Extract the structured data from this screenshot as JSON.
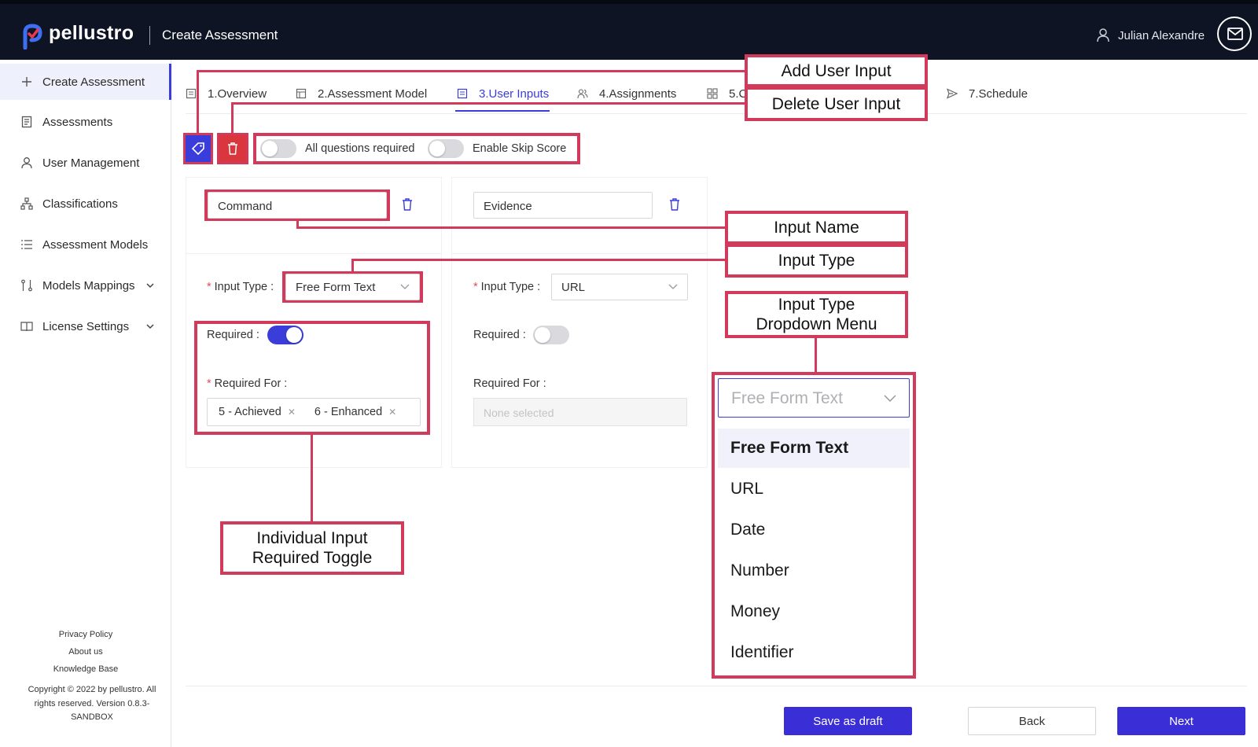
{
  "header": {
    "brand": "pellustro",
    "page_title": "Create Assessment",
    "user_name": "Julian Alexandre"
  },
  "sidebar": {
    "items": [
      {
        "label": "Create Assessment",
        "icon": "plus-icon"
      },
      {
        "label": "Assessments",
        "icon": "document-list-icon"
      },
      {
        "label": "User Management",
        "icon": "user-icon"
      },
      {
        "label": "Classifications",
        "icon": "hierarchy-icon"
      },
      {
        "label": "Assessment Models",
        "icon": "list-icon"
      },
      {
        "label": "Models Mappings",
        "icon": "mapping-icon"
      },
      {
        "label": "License Settings",
        "icon": "book-icon"
      }
    ],
    "footer_links": [
      "Privacy Policy",
      "About us",
      "Knowledge Base"
    ],
    "copyright": "Copyright © 2022 by pellustro. All rights reserved. Version 0.8.3-SANDBOX"
  },
  "tabs": [
    {
      "label": "1.Overview"
    },
    {
      "label": "2.Assessment Model"
    },
    {
      "label": "3.User Inputs"
    },
    {
      "label": "4.Assignments"
    },
    {
      "label": "5.C"
    },
    {
      "label": "7.Schedule"
    }
  ],
  "toolbar": {
    "all_required_label": "All questions required",
    "skip_score_label": "Enable Skip Score"
  },
  "inputs": [
    {
      "name": "Command",
      "input_type_label": "Input Type :",
      "input_type": "Free Form Text",
      "required_label": "Required :",
      "required": true,
      "required_for_label": "Required For :",
      "required_for": [
        "5 - Achieved",
        "6 - Enhanced"
      ]
    },
    {
      "name": "Evidence",
      "input_type_label": "Input Type :",
      "input_type": "URL",
      "required_label": "Required :",
      "required": false,
      "required_for_label": "Required For :",
      "required_for_placeholder": "None selected"
    }
  ],
  "dropdown": {
    "selected_placeholder": "Free Form Text",
    "options": [
      "Free Form Text",
      "URL",
      "Date",
      "Number",
      "Money",
      "Identifier"
    ]
  },
  "annotations": {
    "add_user_input": "Add User Input",
    "delete_user_input": "Delete User Input",
    "input_name": "Input Name",
    "input_type": "Input Type",
    "input_type_dropdown_l1": "Input Type",
    "input_type_dropdown_l2": "Dropdown Menu",
    "required_toggle_l1": "Individual Input",
    "required_toggle_l2": "Required Toggle"
  },
  "buttons": {
    "save_draft": "Save as draft",
    "back": "Back",
    "next": "Next"
  },
  "colors": {
    "accent": "#3a3dd9",
    "annotation": "#d23a5b",
    "header_bg": "#0e1424"
  }
}
